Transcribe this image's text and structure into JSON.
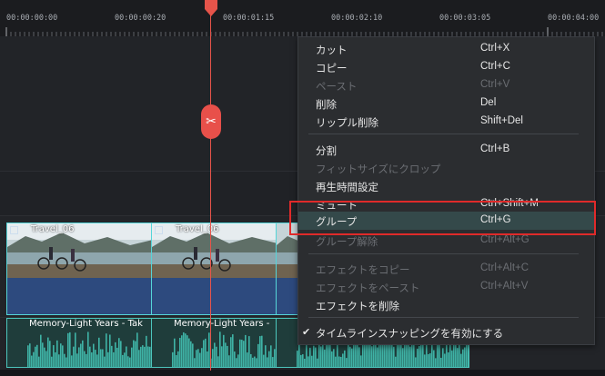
{
  "ruler": {
    "timestamps": [
      "00:00:00:00",
      "00:00:00:20",
      "00:00:01:15",
      "00:00:02:10",
      "00:00:03:05",
      "00:00:04:00"
    ]
  },
  "clips": {
    "video": [
      {
        "label": "Travel_06"
      },
      {
        "label": "Travel_06"
      },
      {
        "label": ""
      }
    ],
    "audio": [
      {
        "label": "Memory-Light Years - Tak"
      },
      {
        "label": "Memory-Light Years -"
      },
      {
        "label": ""
      }
    ]
  },
  "playhead": {
    "icon": "scissors-icon",
    "glyph": "✂"
  },
  "context_menu": {
    "highlighted": "グループ",
    "items": [
      {
        "label": "カット",
        "shortcut": "Ctrl+X",
        "enabled": true
      },
      {
        "label": "コピー",
        "shortcut": "Ctrl+C",
        "enabled": true
      },
      {
        "label": "ペースト",
        "shortcut": "Ctrl+V",
        "enabled": false
      },
      {
        "label": "削除",
        "shortcut": "Del",
        "enabled": true
      },
      {
        "label": "リップル削除",
        "shortcut": "Shift+Del",
        "enabled": true
      },
      {
        "label": "分割",
        "shortcut": "Ctrl+B",
        "enabled": true
      },
      {
        "label": "フィットサイズにクロップ",
        "shortcut": "",
        "enabled": false
      },
      {
        "label": "再生時間設定",
        "shortcut": "",
        "enabled": true
      },
      {
        "label": "ミュート",
        "shortcut": "Ctrl+Shift+M",
        "enabled": true
      },
      {
        "label": "グループ",
        "shortcut": "Ctrl+G",
        "enabled": true
      },
      {
        "label": "グループ解除",
        "shortcut": "Ctrl+Alt+G",
        "enabled": false
      },
      {
        "label": "エフェクトをコピー",
        "shortcut": "Ctrl+Alt+C",
        "enabled": false
      },
      {
        "label": "エフェクトをペースト",
        "shortcut": "Ctrl+Alt+V",
        "enabled": false
      },
      {
        "label": "エフェクトを削除",
        "shortcut": "",
        "enabled": true
      },
      {
        "label": "タイムラインスナッピングを有効にする",
        "shortcut": "",
        "enabled": true,
        "checked": true
      }
    ]
  },
  "colors": {
    "playhead": "#e6544a",
    "video_clip_border": "#55d5d8",
    "audio_wave": "#3fb3a6",
    "annotation_box": "#e02a2a"
  }
}
